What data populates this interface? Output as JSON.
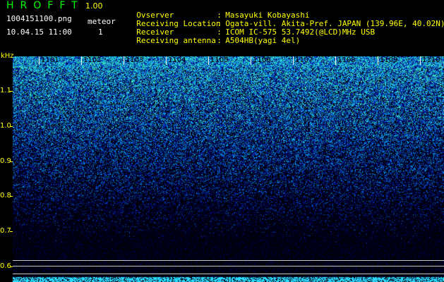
{
  "header": {
    "app_name": "HROFFT",
    "version": "1.00",
    "filename": "1004151100.png",
    "meteor_label": "meteor",
    "timestamp": "10.04.15 11:00",
    "meteor_count": "1"
  },
  "meta": [
    {
      "key": "Ovserver",
      "value": "Masayuki Kobayashi"
    },
    {
      "key": "Receiving Location",
      "value": "Ogata-vill. Akita-Pref. JAPAN (139.96E, 40.02N)"
    },
    {
      "key": "Receiver",
      "value": "ICOM IC-575 53.7492(@LCD)MHz USB"
    },
    {
      "key": "Receiving antenna",
      "value": "A504HB(yagi 4el)"
    }
  ],
  "spectrogram": {
    "y_unit": "kHz",
    "y_ticks": [
      "1.1",
      "1.0",
      "0.9",
      "0.8",
      "0.7",
      "0.6"
    ],
    "x_ticks": [
      "1101",
      "1102",
      "1103",
      "1104",
      "1105",
      "1106",
      "1107",
      "1108",
      "1109",
      "1110"
    ],
    "colors": {
      "background": "#000000",
      "axis": "#ffff00",
      "noise_high": "#00ffa0",
      "noise_mid": "#0060ff",
      "noise_low": "#000060"
    }
  }
}
